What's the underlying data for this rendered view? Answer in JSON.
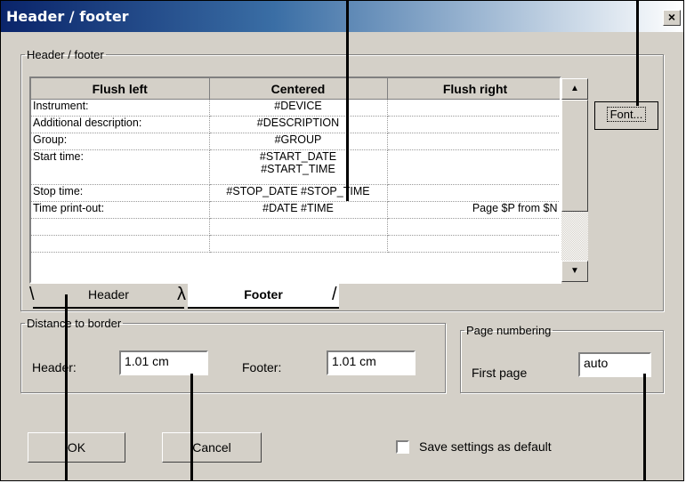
{
  "window": {
    "title": "Header / footer",
    "close_glyph": "×"
  },
  "group_main": {
    "legend": "Header / footer"
  },
  "table": {
    "columns": [
      "Flush left",
      "Centered",
      "Flush right"
    ],
    "rows": [
      [
        "Instrument:",
        "#DEVICE",
        ""
      ],
      [
        "Additional description:",
        "#DESCRIPTION",
        ""
      ],
      [
        "Group:",
        "#GROUP",
        ""
      ],
      [
        "Start time:",
        "#START_DATE\n#START_TIME",
        ""
      ],
      [
        "Stop time:",
        "#STOP_DATE #STOP_TIME",
        ""
      ],
      [
        "Time print-out:",
        "#DATE #TIME",
        "Page $P from  $N"
      ],
      [
        "",
        "",
        ""
      ],
      [
        "",
        "",
        ""
      ]
    ]
  },
  "font_button": {
    "label": "Font..."
  },
  "tabs": [
    {
      "label": "Header",
      "active": false
    },
    {
      "label": "Footer",
      "active": true
    }
  ],
  "distance": {
    "legend": "Distance to border",
    "header_label": "Header:",
    "header_value": "1.01 cm",
    "footer_label": "Footer:",
    "footer_value": "1.01 cm"
  },
  "numbering": {
    "legend": "Page numbering",
    "first_label": "First page",
    "first_value": "auto"
  },
  "buttons": {
    "ok": "OK",
    "cancel": "Cancel"
  },
  "save_default": {
    "label": "Save settings as default",
    "checked": false
  },
  "icons": {
    "scroll_up": "▲",
    "scroll_down": "▼"
  }
}
